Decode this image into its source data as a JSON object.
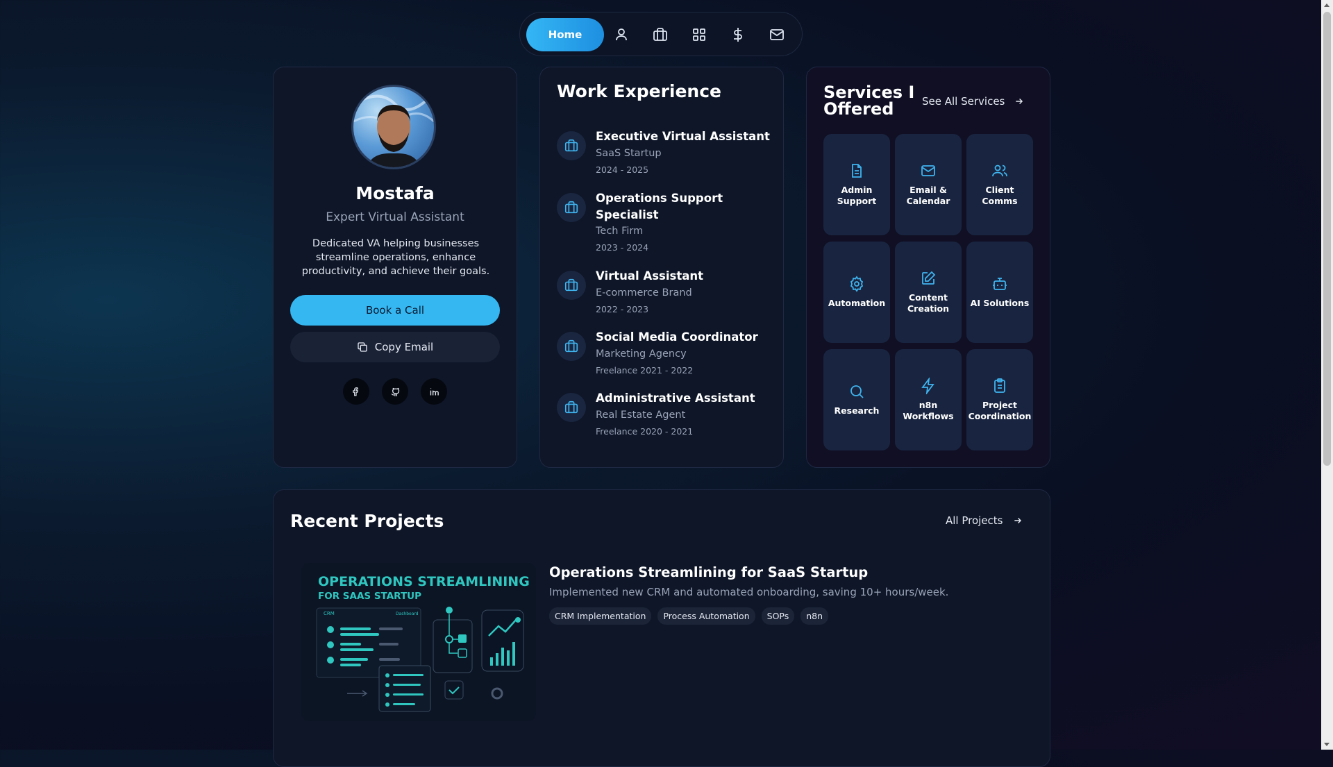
{
  "nav": {
    "home_label": "Home",
    "icons": [
      "user-icon",
      "briefcase-icon",
      "grid-icon",
      "dollar-icon",
      "mail-icon"
    ]
  },
  "profile": {
    "name": "Mostafa",
    "title": "Expert Virtual Assistant",
    "description": "Dedicated VA helping businesses streamline operations, enhance productivity, and achieve their goals.",
    "book_label": "Book a Call",
    "copy_label": "Copy Email",
    "socials": [
      "facebook-icon",
      "github-icon",
      "linkedin-icon"
    ]
  },
  "work": {
    "title": "Work Experience",
    "jobs": [
      {
        "role": "Executive Virtual Assistant",
        "company": "SaaS Startup",
        "dates": "2024 - 2025"
      },
      {
        "role": "Operations Support Specialist",
        "company": "Tech Firm",
        "dates": "2023 - 2024"
      },
      {
        "role": "Virtual Assistant",
        "company": "E-commerce Brand",
        "dates": "2022 - 2023"
      },
      {
        "role": "Social Media Coordinator",
        "company": "Marketing Agency",
        "dates": "Freelance 2021 - 2022"
      },
      {
        "role": "Administrative Assistant",
        "company": "Real Estate Agent",
        "dates": "Freelance 2020 - 2021"
      }
    ]
  },
  "services": {
    "title": "Services I Offered",
    "see_all": "See All Services",
    "items": [
      {
        "label": "Admin Support",
        "icon": "document-icon"
      },
      {
        "label": "Email & Calendar",
        "icon": "mail-icon"
      },
      {
        "label": "Client Comms",
        "icon": "users-icon"
      },
      {
        "label": "Automation",
        "icon": "gear-icon"
      },
      {
        "label": "Content Creation",
        "icon": "edit-icon"
      },
      {
        "label": "AI Solutions",
        "icon": "bot-icon"
      },
      {
        "label": "Research",
        "icon": "search-icon"
      },
      {
        "label": "n8n Workflows",
        "icon": "lightning-icon"
      },
      {
        "label": "Project Coordination",
        "icon": "clipboard-icon"
      }
    ]
  },
  "projects": {
    "title": "Recent Projects",
    "all_label": "All Projects",
    "items": [
      {
        "name": "Operations Streamlining for SaaS Startup",
        "description": "Implemented new CRM and automated onboarding, saving 10+ hours/week.",
        "tags": [
          "CRM Implementation",
          "Process Automation",
          "SOPs",
          "n8n"
        ],
        "thumb_heading": "OPERATIONS STREAMLINING",
        "thumb_subheading": "FOR SAAS STARTUP",
        "thumb_crm": "CRM",
        "thumb_dashboard": "Dashboard"
      }
    ]
  },
  "colors": {
    "accent": "#35b8f2",
    "card": "#0e1628",
    "tile": "#192540"
  }
}
